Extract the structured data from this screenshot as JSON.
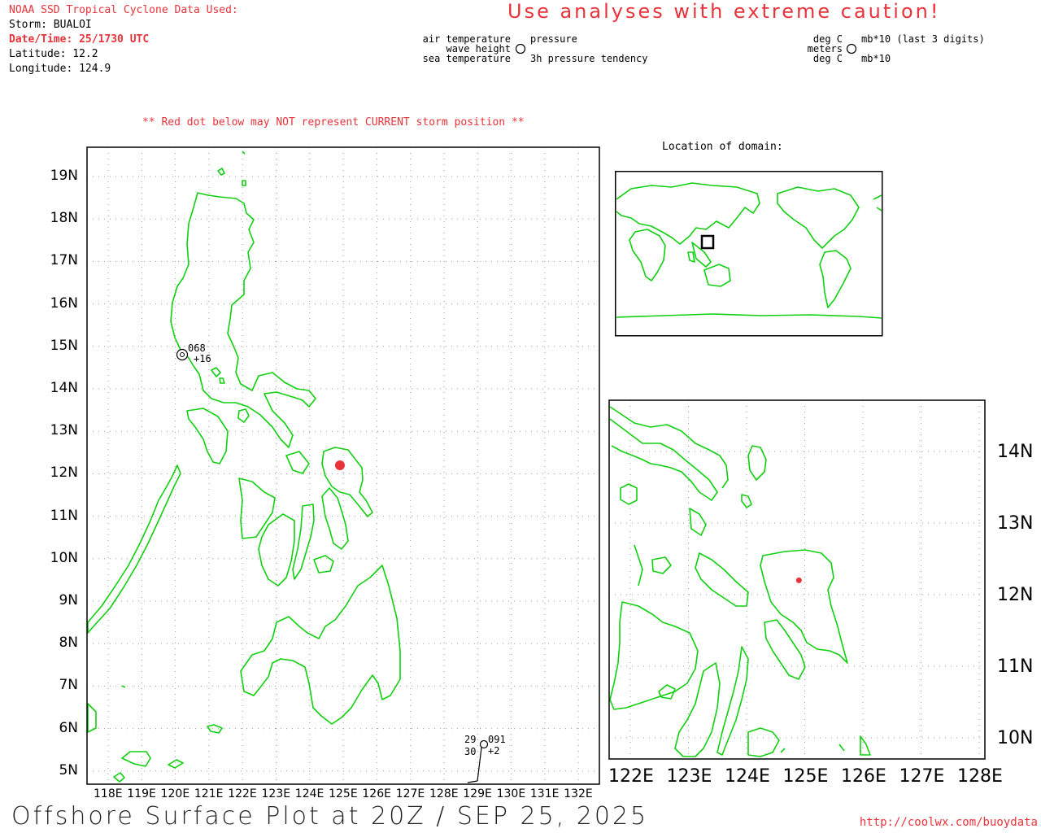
{
  "header": {
    "source": "NOAA SSD Tropical Cyclone Data Used:",
    "storm": "Storm: BUALOI",
    "datetime": "Date/Time: 25/1730 UTC",
    "latitude": "Latitude: 12.2",
    "longitude": "Longitude: 124.9"
  },
  "caution": "Use analyses with extreme caution!",
  "legend": {
    "left": {
      "air_temp": "air temperature",
      "wave_height": "wave height",
      "sea_temp": "sea temperature",
      "pressure": "pressure",
      "tendency": "3h pressure tendency"
    },
    "right": {
      "deg_c_top": "deg C",
      "meters": "meters",
      "deg_c_bottom": "deg C",
      "mb_last3": "mb*10 (last 3 digits)",
      "mb": "mb*10"
    }
  },
  "warning": "** Red dot below may NOT represent CURRENT storm position **",
  "domain_title": "Location of domain:",
  "main_map": {
    "lat_ticks": [
      "19N",
      "18N",
      "17N",
      "16N",
      "15N",
      "14N",
      "13N",
      "12N",
      "11N",
      "10N",
      "9N",
      "8N",
      "7N",
      "6N",
      "5N"
    ],
    "lon_ticks": [
      "118E",
      "119E",
      "120E",
      "121E",
      "122E",
      "123E",
      "124E",
      "125E",
      "126E",
      "127E",
      "128E",
      "129E",
      "130E",
      "131E",
      "132E"
    ],
    "storm_position": {
      "lat": 12.2,
      "lon": 124.9
    }
  },
  "zoom_map": {
    "lat_ticks": [
      "14N",
      "13N",
      "12N",
      "11N",
      "10N"
    ],
    "lon_ticks": [
      "122E",
      "123E",
      "124E",
      "125E",
      "126E",
      "127E",
      "128E"
    ]
  },
  "stations": [
    {
      "id": "luzon",
      "pressure": "068",
      "tendency": "+16",
      "air_temp": "",
      "sea_temp": ""
    },
    {
      "id": "east",
      "pressure": "091",
      "tendency": "+2",
      "air_temp": "29",
      "sea_temp": "30"
    }
  ],
  "footer": {
    "title": "Offshore Surface Plot at 20Z / SEP 25, 2025",
    "url": "http://coolwx.com/buoydata"
  },
  "colors": {
    "coast": "#10d010",
    "storm": "#e8333a",
    "text_red": "#e8333a"
  }
}
